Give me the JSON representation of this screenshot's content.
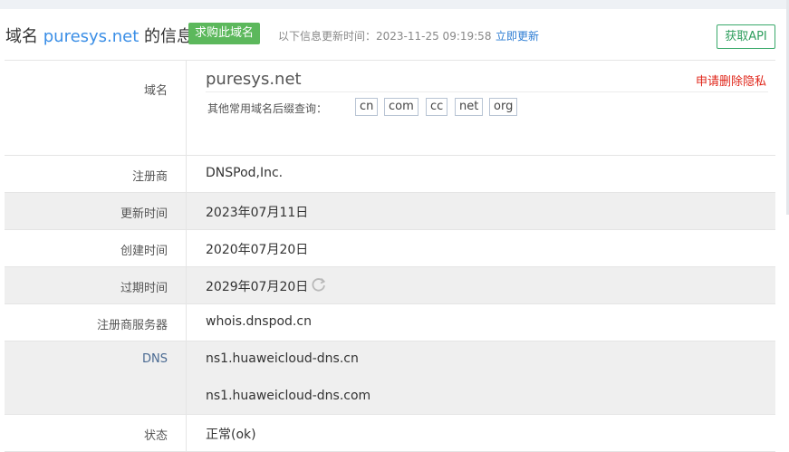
{
  "header": {
    "title_prefix": "域名 ",
    "domain": "puresys.net",
    "title_suffix": " 的信息",
    "buy_label": "求购此域名",
    "updated_text": "以下信息更新时间：2023-11-25 09:19:58",
    "update_now_label": "立即更新",
    "api_label": "获取API"
  },
  "domain_row": {
    "label": "域名",
    "value": "puresys.net",
    "remove_privacy_label": "申请删除隐私",
    "suffix_query_label": "其他常用域名后缀查询：",
    "suffixes": [
      "cn",
      "com",
      "cc",
      "net",
      "org"
    ]
  },
  "rows": {
    "registrar": {
      "label": "注册商",
      "value": "DNSPod,Inc."
    },
    "updated": {
      "label": "更新时间",
      "value": "2023年07月11日"
    },
    "created": {
      "label": "创建时间",
      "value": "2020年07月20日"
    },
    "expires": {
      "label": "过期时间",
      "value": "2029年07月20日"
    },
    "whois_server": {
      "label": "注册商服务器",
      "value": "whois.dnspod.cn"
    },
    "dns": {
      "label": "DNS",
      "values": [
        "ns1.huaweicloud-dns.cn",
        "ns1.huaweicloud-dns.com"
      ]
    },
    "status": {
      "label": "状态",
      "value": "正常(ok)"
    }
  },
  "icons": {
    "refresh": "refresh-icon"
  },
  "colors": {
    "link": "#2b7cd3",
    "brand_green": "#5cb85c",
    "alert_red": "#e0261a"
  }
}
